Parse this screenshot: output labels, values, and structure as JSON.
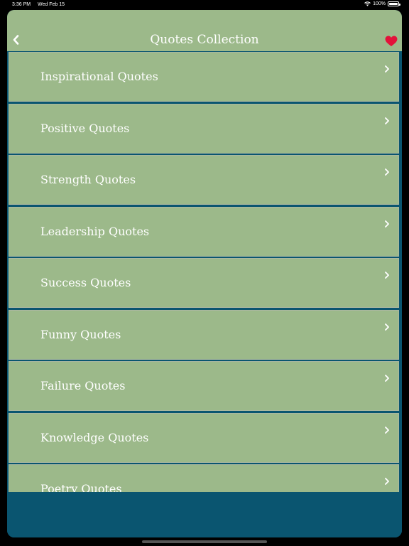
{
  "status_bar": {
    "time": "3:36 PM",
    "date": "Wed Feb 15",
    "battery": "100%",
    "icons": [
      "wifi-icon",
      "battery-icon"
    ]
  },
  "nav": {
    "title": "Quotes Collection",
    "back_icon": "back-chevron-icon",
    "favorite_icon": "heart-icon",
    "favorite_color": "#e3123a"
  },
  "colors": {
    "item_background": "#9cb98a",
    "separator": "#0a5570",
    "text": "#ffffff"
  },
  "categories": [
    {
      "label": "Inspirational Quotes"
    },
    {
      "label": "Positive Quotes"
    },
    {
      "label": "Strength Quotes"
    },
    {
      "label": "Leadership Quotes"
    },
    {
      "label": "Success Quotes"
    },
    {
      "label": "Funny Quotes"
    },
    {
      "label": "Failure Quotes"
    },
    {
      "label": "Knowledge Quotes"
    },
    {
      "label": "Poetry Quotes"
    }
  ]
}
